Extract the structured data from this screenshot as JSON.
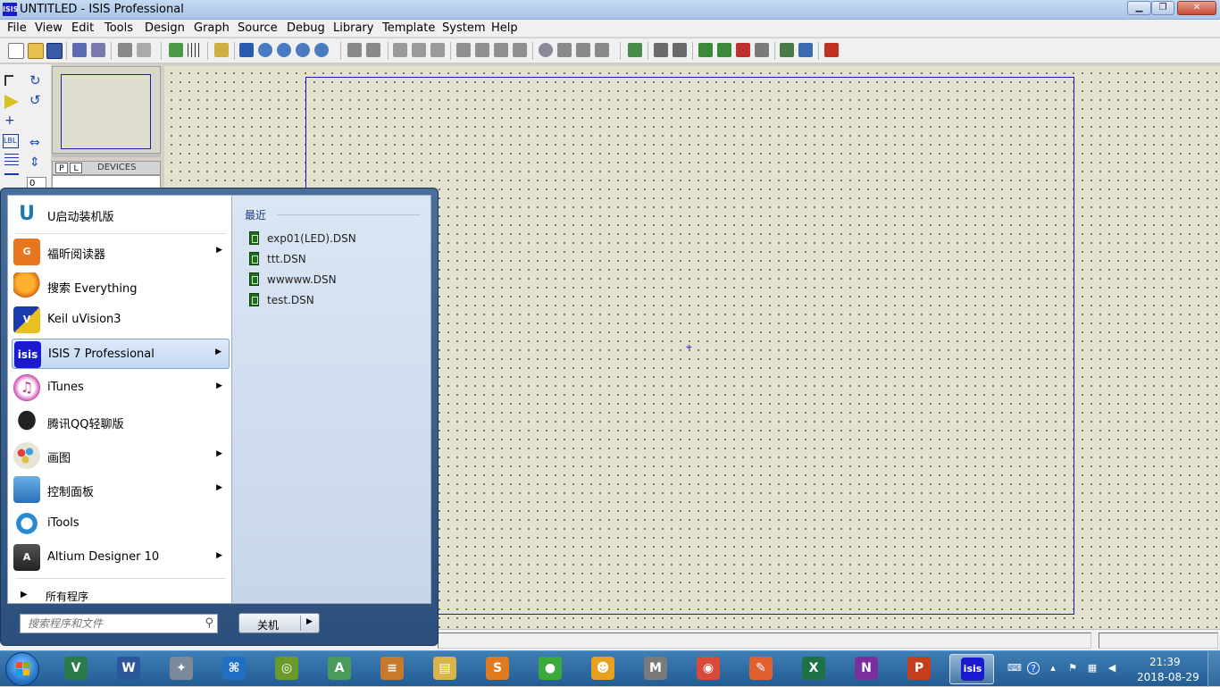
{
  "window": {
    "title": "UNTITLED - ISIS Professional",
    "app_icon": "ISIS",
    "min_glyph": "▁",
    "max_glyph": "❐",
    "close_glyph": "✕"
  },
  "menubar": [
    "File",
    "View",
    "Edit",
    "Tools",
    "Design",
    "Graph",
    "Source",
    "Debug",
    "Library",
    "Template",
    "System",
    "Help"
  ],
  "left_tools": {
    "angle_value": "0"
  },
  "devices": {
    "p_button": "P",
    "l_button": "L",
    "label": "DEVICES"
  },
  "start_menu": {
    "pinned": [
      {
        "label": "U启动装机版",
        "icon": "u-start-icon",
        "submenu": false
      },
      {
        "label": "福昕阅读器",
        "icon": "foxit-pdf-icon",
        "submenu": true
      },
      {
        "label": "搜索 Everything",
        "icon": "everything-search-icon",
        "submenu": false
      },
      {
        "label": "Keil uVision3",
        "icon": "keil-icon",
        "submenu": false
      },
      {
        "label": "ISIS 7 Professional",
        "icon": "isis-icon",
        "submenu": true
      },
      {
        "label": "iTunes",
        "icon": "itunes-icon",
        "submenu": true
      },
      {
        "label": "腾讯QQ轻聊版",
        "icon": "qq-icon",
        "submenu": false
      },
      {
        "label": "画图",
        "icon": "paint-icon",
        "submenu": true
      },
      {
        "label": "控制面板",
        "icon": "control-panel-icon",
        "submenu": true
      },
      {
        "label": "iTools",
        "icon": "itools-icon",
        "submenu": false
      },
      {
        "label": "Altium Designer 10",
        "icon": "altium-icon",
        "submenu": true
      }
    ],
    "pinned_icon_text": [
      "U",
      "G",
      "",
      "V",
      "isis",
      "♫",
      "",
      "",
      "",
      "",
      "A"
    ],
    "all_programs": "所有程序",
    "recent_title": "最近",
    "recent": [
      "exp01(LED).DSN",
      "ttt.DSN",
      "wwwww.DSN",
      "test.DSN"
    ],
    "search_placeholder": "搜索程序和文件",
    "shutdown_label": "关机"
  },
  "taskbar": {
    "apps": [
      {
        "name": "visio-icon",
        "glyph": "V",
        "color": "#2a7a4a"
      },
      {
        "name": "word-icon",
        "glyph": "W",
        "color": "#2b579a"
      },
      {
        "name": "satellite-icon",
        "glyph": "✦",
        "color": "#7a8a9a"
      },
      {
        "name": "vscode-icon",
        "glyph": "⌘",
        "color": "#1f6fc4"
      },
      {
        "name": "origin-icon",
        "glyph": "◎",
        "color": "#6a9a2a"
      },
      {
        "name": "android-studio-icon",
        "glyph": "A",
        "color": "#4a9a5a"
      },
      {
        "name": "stack-app-icon",
        "glyph": "≡",
        "color": "#c87a2a"
      },
      {
        "name": "file-explorer-icon",
        "glyph": "▤",
        "color": "#d8b44a"
      },
      {
        "name": "sublime-icon",
        "glyph": "S",
        "color": "#e07a20"
      },
      {
        "name": "wechat-icon",
        "glyph": "●",
        "color": "#3aaa3a"
      },
      {
        "name": "duck-app-icon",
        "glyph": "☻",
        "color": "#e8a020"
      },
      {
        "name": "mathtype-icon",
        "glyph": "M",
        "color": "#7a7a7a"
      },
      {
        "name": "chrome-icon",
        "glyph": "◉",
        "color": "#d84a3a"
      },
      {
        "name": "tool-icon",
        "glyph": "✎",
        "color": "#e06030"
      },
      {
        "name": "excel-icon",
        "glyph": "X",
        "color": "#1e7145"
      },
      {
        "name": "onenote-icon",
        "glyph": "N",
        "color": "#7b2f9e"
      },
      {
        "name": "powerpoint-icon",
        "glyph": "P",
        "color": "#c43e1c"
      },
      {
        "name": "isis-taskbar-icon",
        "glyph": "isis",
        "color": "#1a1ad0",
        "active": true
      }
    ],
    "clock_time": "21:39",
    "clock_date": "2018-08-29"
  }
}
